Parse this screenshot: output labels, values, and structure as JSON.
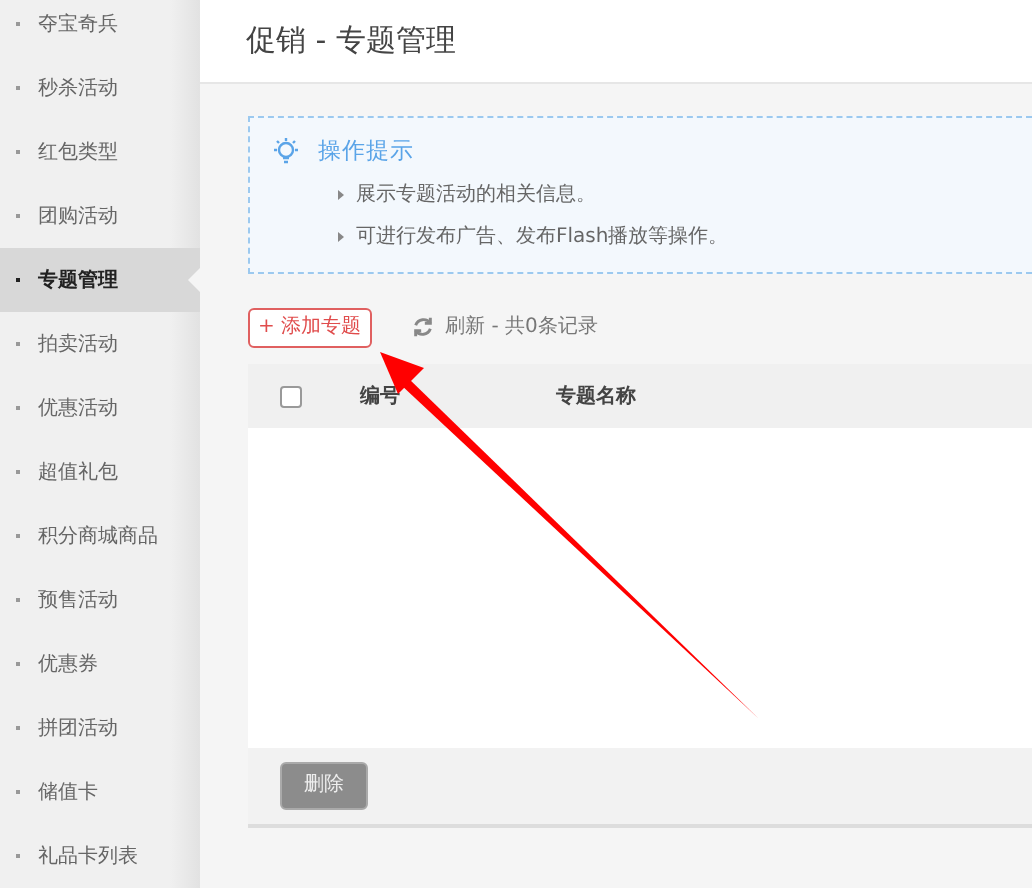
{
  "sidebar": {
    "items": [
      {
        "label": "夺宝奇兵",
        "selected": false
      },
      {
        "label": "秒杀活动",
        "selected": false
      },
      {
        "label": "红包类型",
        "selected": false
      },
      {
        "label": "团购活动",
        "selected": false
      },
      {
        "label": "专题管理",
        "selected": true
      },
      {
        "label": "拍卖活动",
        "selected": false
      },
      {
        "label": "优惠活动",
        "selected": false
      },
      {
        "label": "超值礼包",
        "selected": false
      },
      {
        "label": "积分商城商品",
        "selected": false
      },
      {
        "label": "预售活动",
        "selected": false
      },
      {
        "label": "优惠券",
        "selected": false
      },
      {
        "label": "拼团活动",
        "selected": false
      },
      {
        "label": "储值卡",
        "selected": false
      },
      {
        "label": "礼品卡列表",
        "selected": false
      }
    ]
  },
  "page_title": "促销 - 专题管理",
  "tips": {
    "title": "操作提示",
    "items": [
      "展示专题活动的相关信息。",
      "可进行发布广告、发布Flash播放等操作。"
    ]
  },
  "toolbar": {
    "add_button": "+ 添加专题",
    "refresh": "刷新 - 共0条记录"
  },
  "table": {
    "select_all_checked": false,
    "columns": [
      "编号",
      "专题名称"
    ]
  },
  "footer": {
    "delete_button": "删除"
  }
}
